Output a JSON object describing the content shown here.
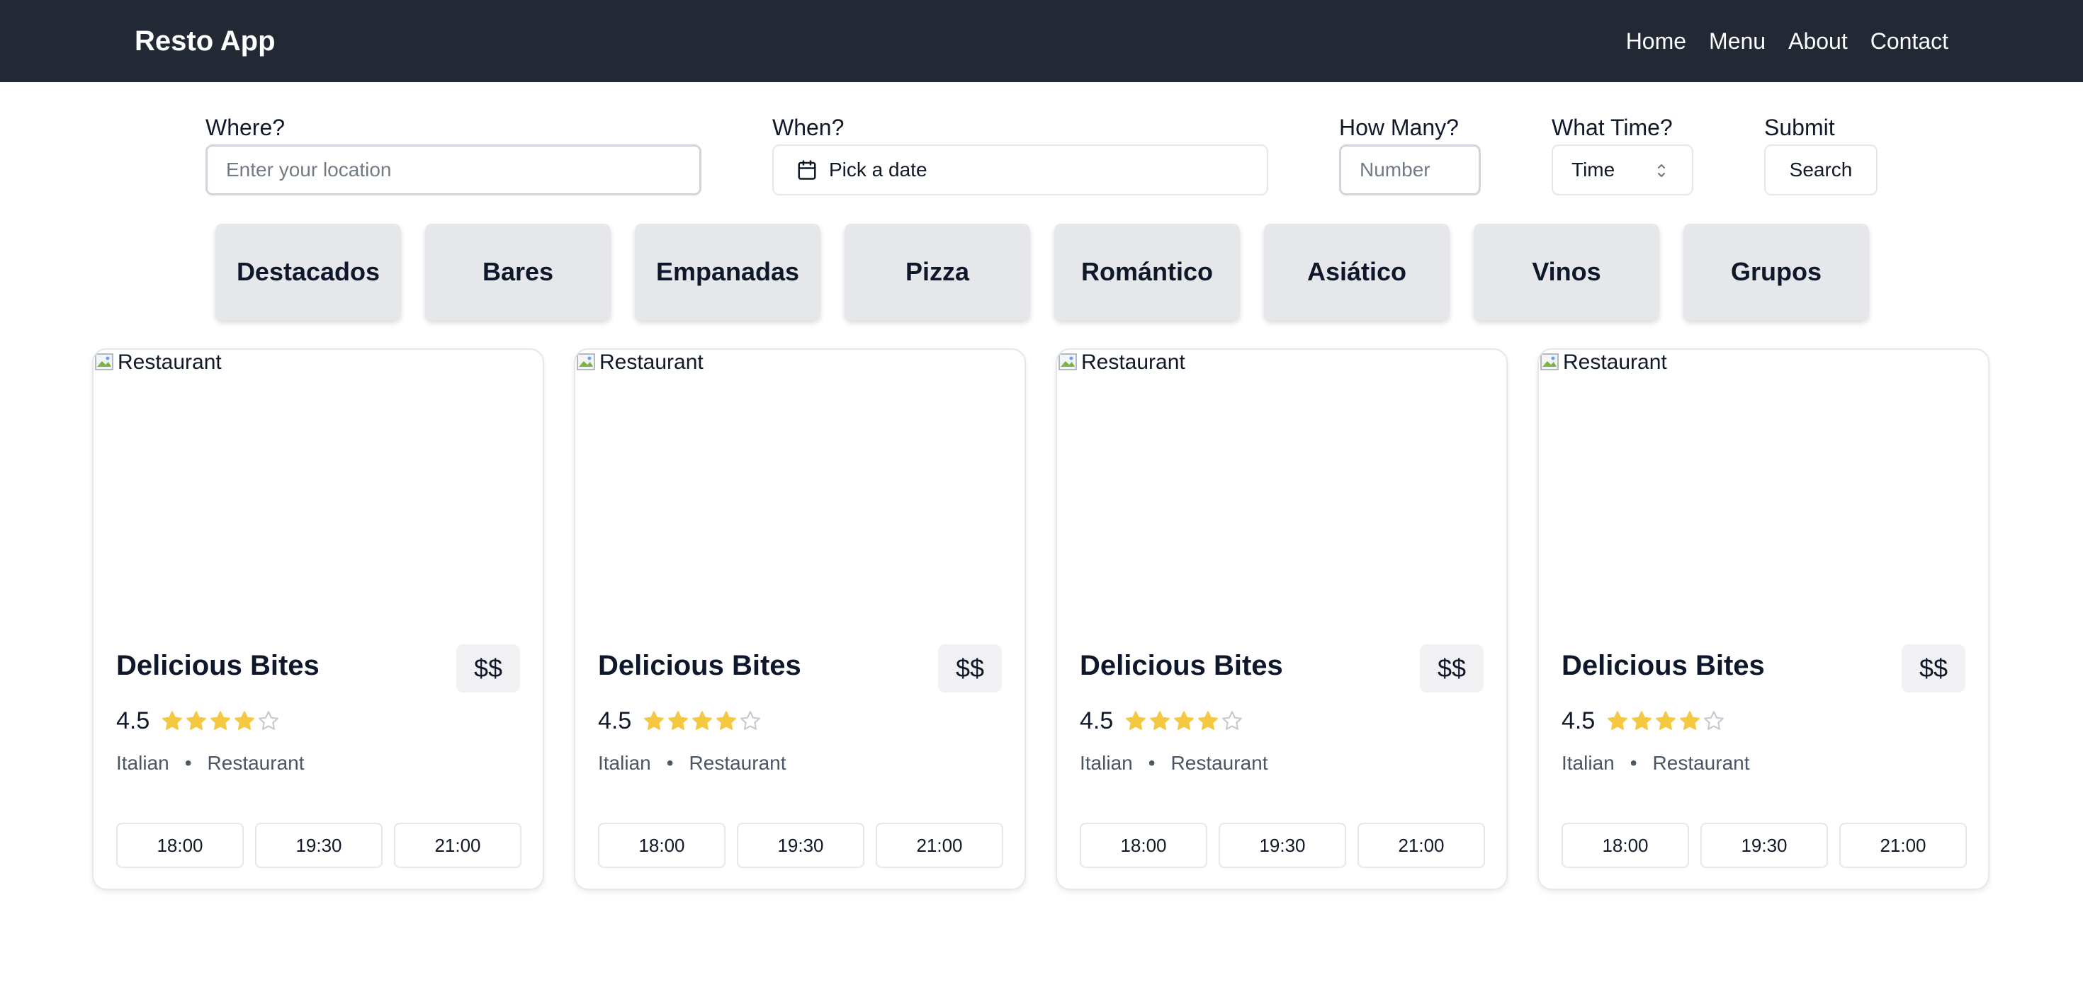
{
  "app": {
    "brand": "Resto App"
  },
  "nav": {
    "links": [
      "Home",
      "Menu",
      "About",
      "Contact"
    ]
  },
  "search": {
    "where_label": "Where?",
    "where_placeholder": "Enter your location",
    "when_label": "When?",
    "when_value": "Pick a date",
    "how_many_label": "How Many?",
    "how_many_placeholder": "Number",
    "time_label": "What Time?",
    "time_value": "Time",
    "submit_label": "Submit",
    "search_button": "Search"
  },
  "categories": [
    "Destacados",
    "Bares",
    "Empanadas",
    "Pizza",
    "Romántico",
    "Asiático",
    "Vinos",
    "Grupos"
  ],
  "colors": {
    "navbar": "#222935",
    "star": "#f5c842",
    "category_bg": "#e5e7eb"
  },
  "restaurants": [
    {
      "image_alt": "Restaurant",
      "name": "Delicious Bites",
      "price": "$$",
      "rating": "4.5",
      "stars_filled": 4,
      "stars_total": 5,
      "cuisine": "Italian",
      "type": "Restaurant",
      "times": [
        "18:00",
        "19:30",
        "21:00"
      ]
    },
    {
      "image_alt": "Restaurant",
      "name": "Delicious Bites",
      "price": "$$",
      "rating": "4.5",
      "stars_filled": 4,
      "stars_total": 5,
      "cuisine": "Italian",
      "type": "Restaurant",
      "times": [
        "18:00",
        "19:30",
        "21:00"
      ]
    },
    {
      "image_alt": "Restaurant",
      "name": "Delicious Bites",
      "price": "$$",
      "rating": "4.5",
      "stars_filled": 4,
      "stars_total": 5,
      "cuisine": "Italian",
      "type": "Restaurant",
      "times": [
        "18:00",
        "19:30",
        "21:00"
      ]
    },
    {
      "image_alt": "Restaurant",
      "name": "Delicious Bites",
      "price": "$$",
      "rating": "4.5",
      "stars_filled": 4,
      "stars_total": 5,
      "cuisine": "Italian",
      "type": "Restaurant",
      "times": [
        "18:00",
        "19:30",
        "21:00"
      ]
    }
  ]
}
